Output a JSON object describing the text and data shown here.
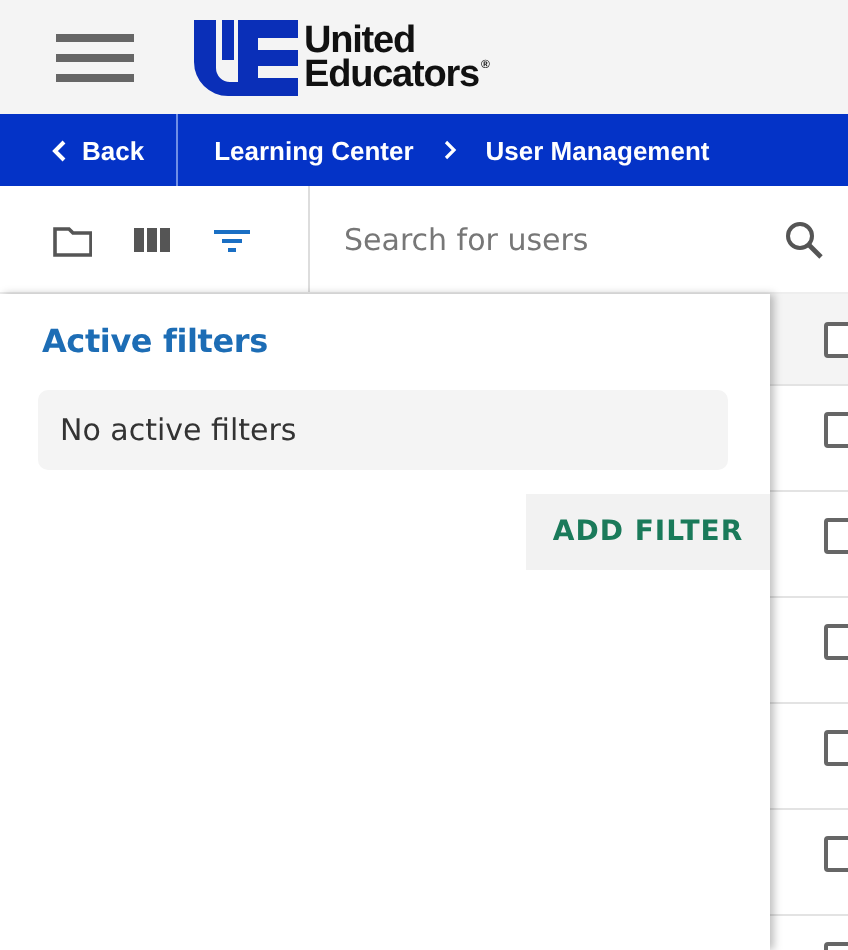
{
  "header": {
    "logo_line_1": "United",
    "logo_line_2": "Educators",
    "logo_mark": "®"
  },
  "breadcrumb": {
    "back": "Back",
    "items": [
      {
        "label": "Learning Center"
      },
      {
        "label": "User Management"
      }
    ]
  },
  "toolbar": {
    "icons": [
      {
        "kind": "folder",
        "selected": false
      },
      {
        "kind": "columns",
        "selected": false
      },
      {
        "kind": "filter",
        "selected": true
      }
    ],
    "search": {
      "placeholder": "Search for users"
    }
  },
  "filter_panel": {
    "title": "Active filters",
    "empty_message": "No active filters",
    "add_button": "ADD FILTER"
  },
  "table": {
    "header_checkbox": {
      "checked": false
    },
    "rows": [
      {
        "checked": false
      },
      {
        "checked": false
      },
      {
        "checked": false
      },
      {
        "checked": false
      },
      {
        "checked": false
      },
      {
        "checked": false
      }
    ]
  }
}
